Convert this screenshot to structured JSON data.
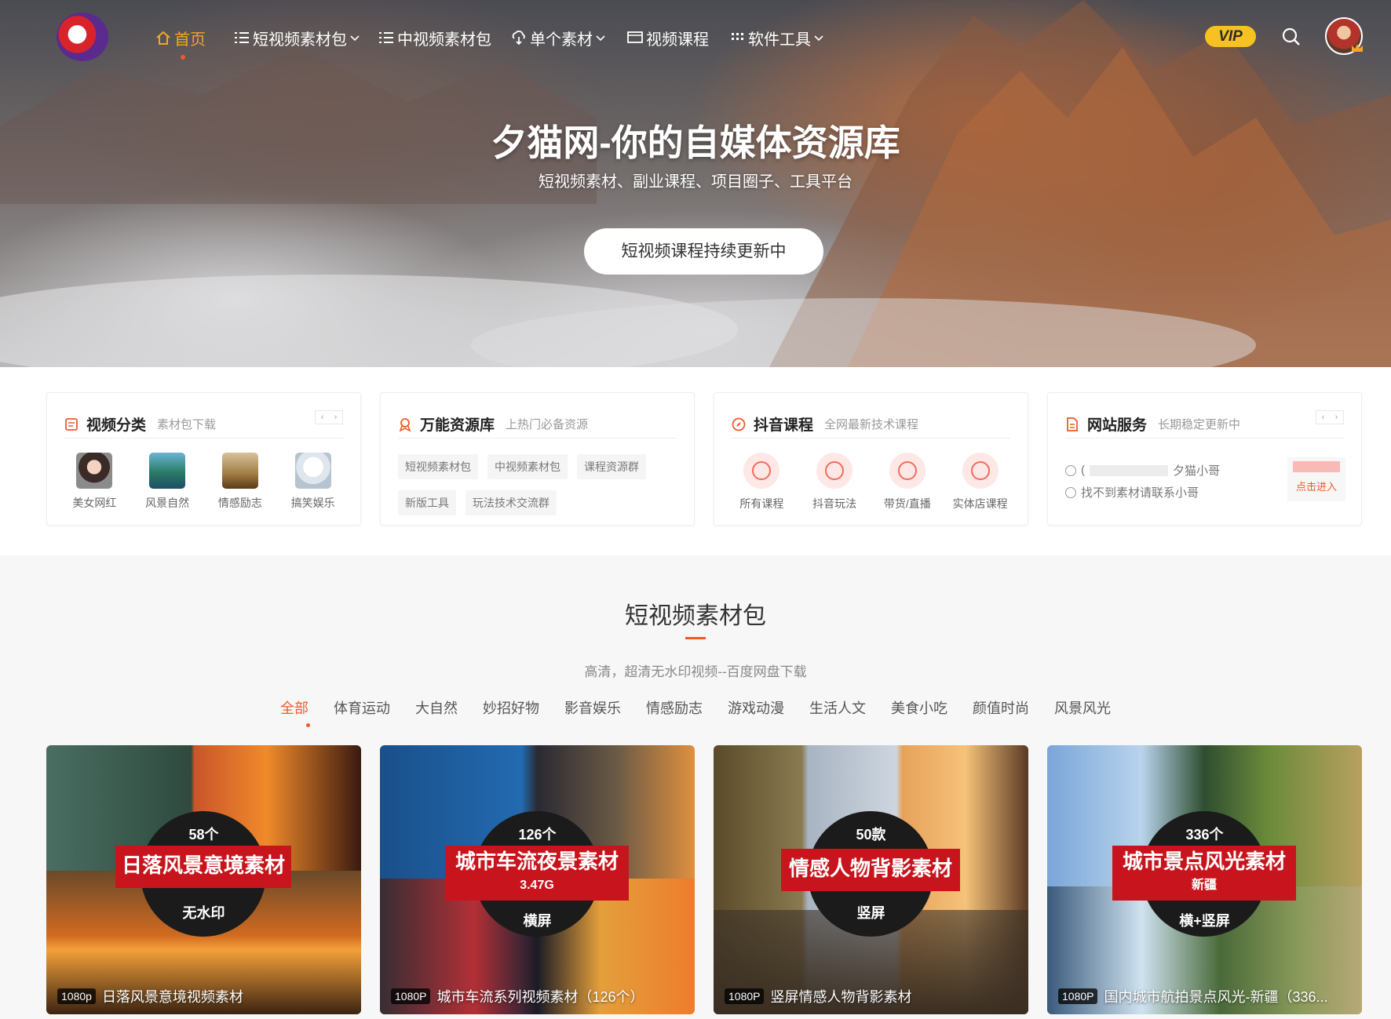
{
  "nav": {
    "items": [
      {
        "label": "首页",
        "icon": "home-icon"
      },
      {
        "label": "短视频素材包",
        "icon": "list-icon",
        "dropdown": true
      },
      {
        "label": "中视频素材包",
        "icon": "list-icon"
      },
      {
        "label": "单个素材",
        "icon": "download-cloud-icon",
        "dropdown": true
      },
      {
        "label": "视频课程",
        "icon": "monitor-icon"
      },
      {
        "label": "软件工具",
        "icon": "grid-icon",
        "dropdown": true
      }
    ],
    "vip": "VIP"
  },
  "hero": {
    "title": "夕猫网-你的自媒体资源库",
    "subtitle": "短视频素材、副业课程、项目圈子、工具平台",
    "button": "短视频课程持续更新中"
  },
  "cards": {
    "category": {
      "title": "视频分类",
      "sub": "素材包下载",
      "items": [
        "美女网红",
        "风景自然",
        "情感励志",
        "搞笑娱乐"
      ]
    },
    "resources": {
      "title": "万能资源库",
      "sub": "上热门必备资源",
      "tags": [
        "短视频素材包",
        "中视频素材包",
        "课程资源群",
        "新版工具",
        "玩法技术交流群"
      ]
    },
    "douyin": {
      "title": "抖音课程",
      "sub": "全网最新技术课程",
      "items": [
        "所有课程",
        "抖音玩法",
        "带货/直播",
        "实体店课程"
      ]
    },
    "service": {
      "title": "网站服务",
      "sub": "长期稳定更新中",
      "line1_prefix": "(",
      "line1_suffix": "夕猫小哥",
      "line2": "找不到素材请联系小哥",
      "button": "点击进入"
    }
  },
  "section": {
    "title": "短视频素材包",
    "subtitle": "高清，超清无水印视频--百度网盘下载",
    "filters": [
      "全部",
      "体育运动",
      "大自然",
      "妙招好物",
      "影音娱乐",
      "情感励志",
      "游戏动漫",
      "生活人文",
      "美食小吃",
      "颜值时尚",
      "风景风光"
    ]
  },
  "tiles": [
    {
      "top": "58个",
      "main": "日落风景意境素材",
      "bottom": "无水印",
      "res": "1080p",
      "caption": "日落风景意境视频素材"
    },
    {
      "top": "126个",
      "main": "城市车流夜景素材",
      "extra": "3.47G",
      "bottom": "横屏",
      "res": "1080P",
      "caption": "城市车流系列视频素材（126个）"
    },
    {
      "top": "50款",
      "main": "情感人物背影素材",
      "bottom": "竖屏",
      "res": "1080P",
      "caption": "竖屏情感人物背影素材"
    },
    {
      "top": "336个",
      "main": "城市景点风光素材",
      "extra": "新疆",
      "bottom": "横+竖屏",
      "res": "1080P",
      "caption": "国内城市航拍景点风光-新疆（336..."
    }
  ]
}
